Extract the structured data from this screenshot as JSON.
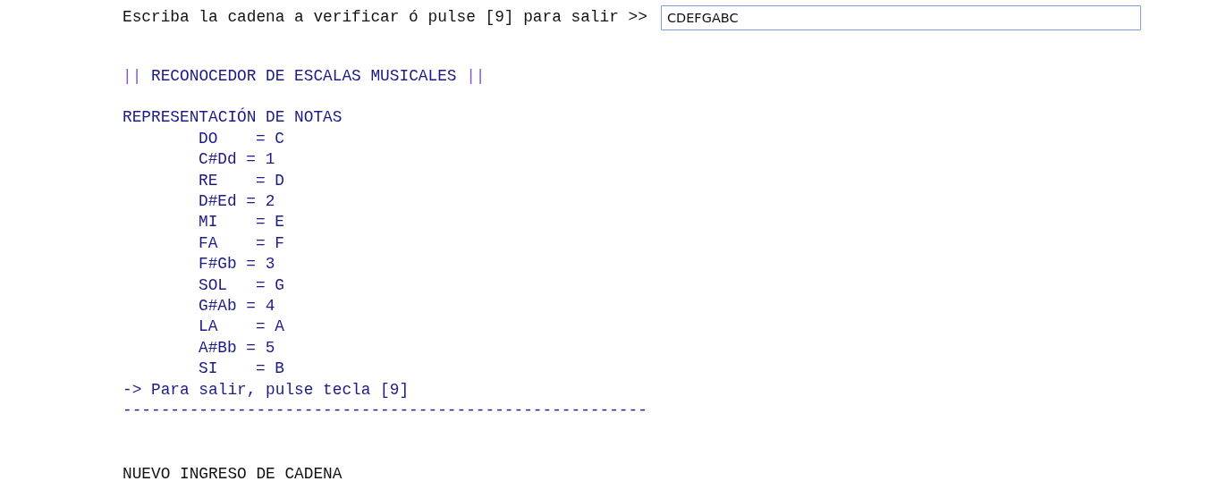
{
  "prompt": {
    "label": "Escriba la cadena a verificar ó pulse [9] para salir >>",
    "value": "CDEFGABC"
  },
  "title": {
    "left_mark": "||",
    "text": "RECONOCEDOR DE ESCALAS MUSICALES",
    "right_mark": "||"
  },
  "notes_heading": "REPRESENTACIÓN DE NOTAS",
  "notes": [
    "DO    = C",
    "C#Dd = 1",
    "RE    = D",
    "D#Ed = 2",
    "MI    = E",
    "FA    = F",
    "F#Gb = 3",
    "SOL   = G",
    "G#Ab = 4",
    "LA    = A",
    "A#Bb = 5",
    "SI    = B"
  ],
  "exit_hint": "-> Para salir, pulse tecla [9]",
  "divider": "-------------------------------------------------------",
  "next_heading": "NUEVO INGRESO DE CADENA"
}
